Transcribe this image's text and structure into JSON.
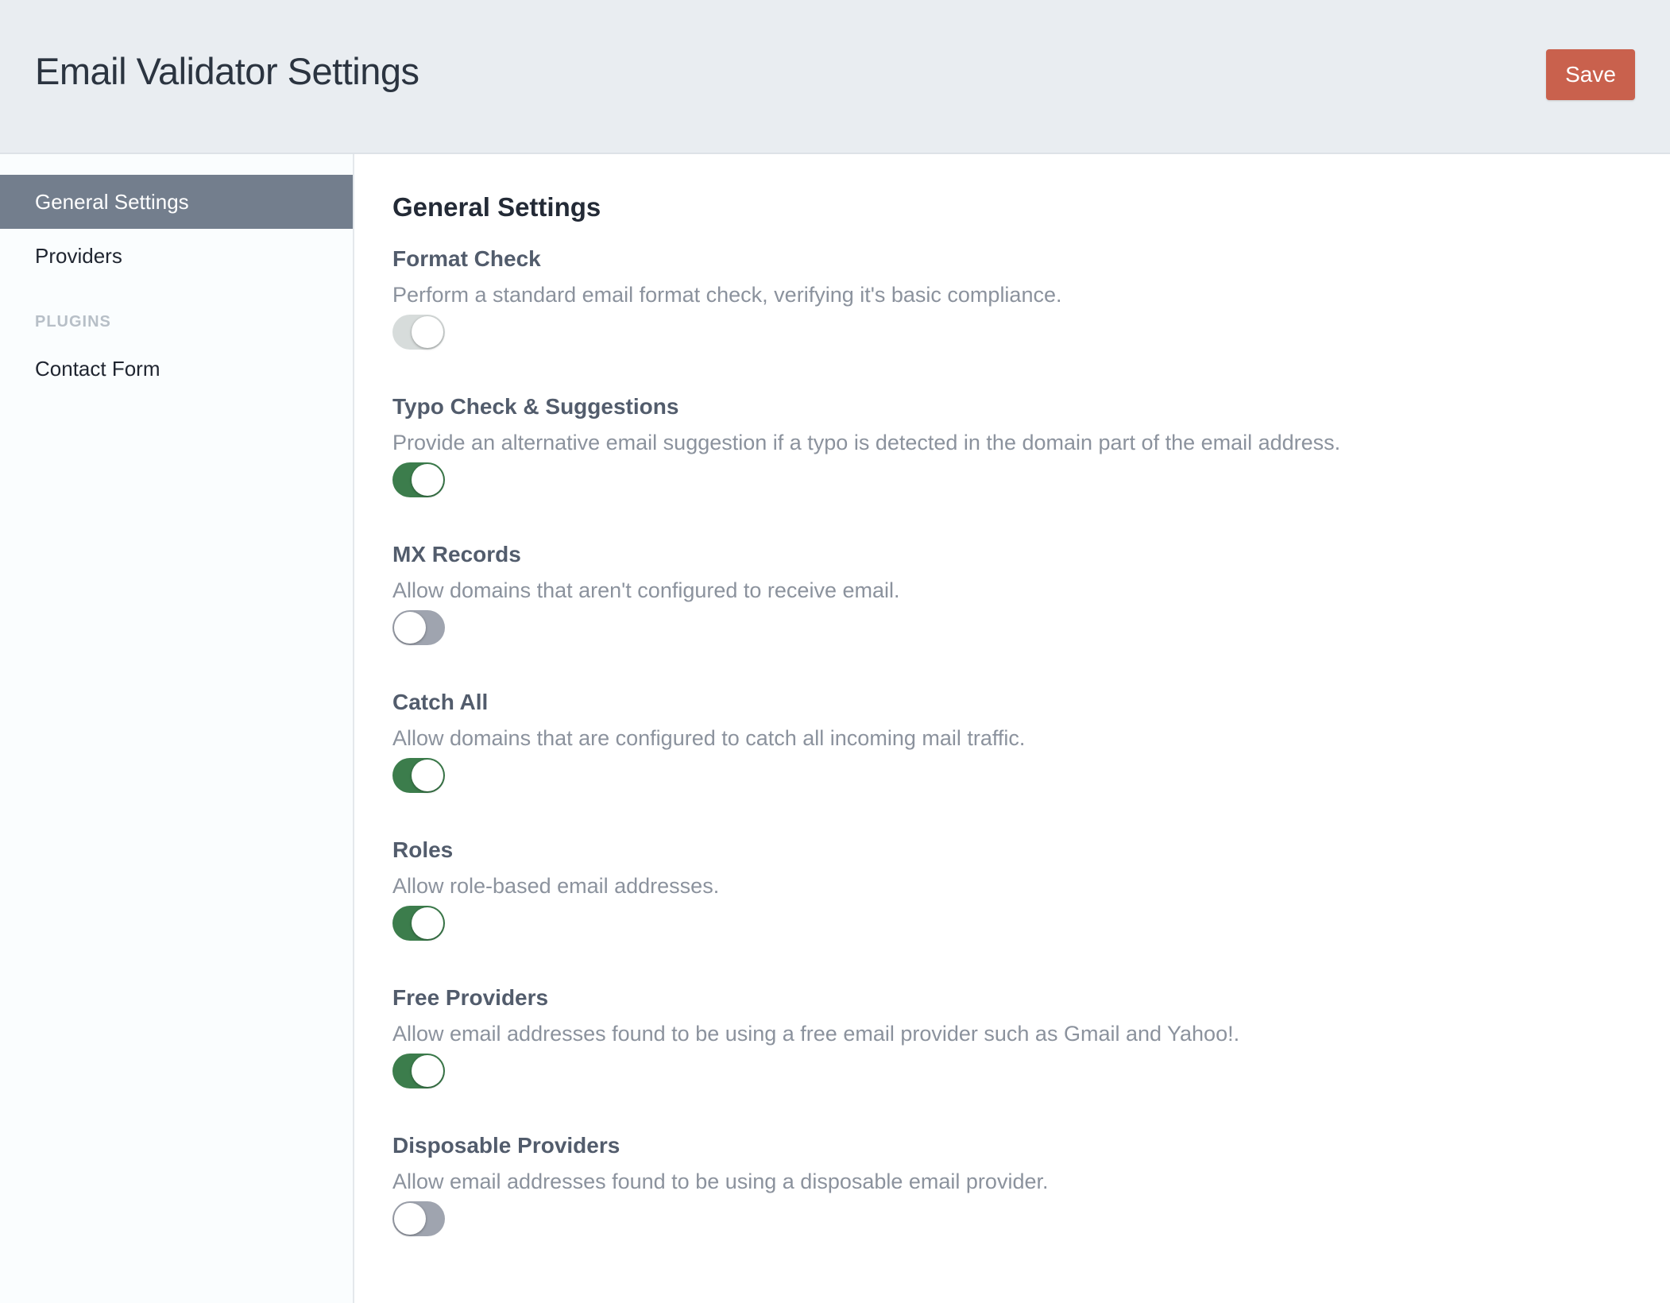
{
  "header": {
    "title": "Email Validator Settings",
    "save_label": "Save"
  },
  "sidebar": {
    "items": [
      {
        "label": "General Settings",
        "active": true
      },
      {
        "label": "Providers",
        "active": false
      }
    ],
    "plugins_section": "PLUGINS",
    "plugin_items": [
      {
        "label": "Contact Form"
      }
    ]
  },
  "main": {
    "title": "General Settings",
    "settings": [
      {
        "title": "Format Check",
        "description": "Perform a standard email format check, verifying it's basic compliance.",
        "state": "on-disabled"
      },
      {
        "title": "Typo Check & Suggestions",
        "description": "Provide an alternative email suggestion if a typo is detected in the domain part of the email address.",
        "state": "on"
      },
      {
        "title": "MX Records",
        "description": "Allow domains that aren't configured to receive email.",
        "state": "off"
      },
      {
        "title": "Catch All",
        "description": "Allow domains that are configured to catch all incoming mail traffic.",
        "state": "on"
      },
      {
        "title": "Roles",
        "description": "Allow role-based email addresses.",
        "state": "on"
      },
      {
        "title": "Free Providers",
        "description": "Allow email addresses found to be using a free email provider such as Gmail and Yahoo!.",
        "state": "on"
      },
      {
        "title": "Disposable Providers",
        "description": "Allow email addresses found to be using a disposable email provider.",
        "state": "off"
      }
    ]
  },
  "colors": {
    "accent": "#c9614d",
    "toggle_on": "#3c7d4c",
    "toggle_off": "#9fa4af",
    "sidebar_active": "#737e8d"
  }
}
